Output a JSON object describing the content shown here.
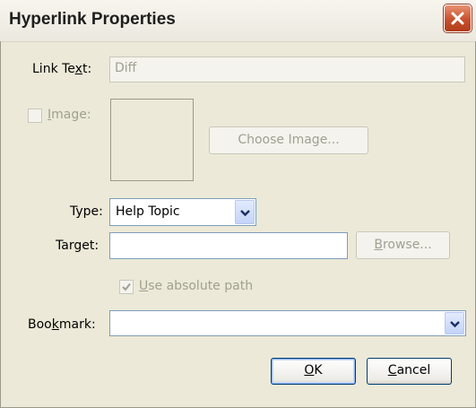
{
  "window": {
    "title": "Hyperlink Properties"
  },
  "link_text": {
    "label_pre": "Link Te",
    "label_accel": "x",
    "label_post": "t:",
    "value": "Diff"
  },
  "image": {
    "label_accel": "I",
    "label_post": "mage:",
    "checked": false,
    "choose_button_label": "Choose Image..."
  },
  "type": {
    "label": "Type:",
    "value": "Help Topic"
  },
  "target": {
    "label": "Target:",
    "value": "",
    "browse_accel": "B",
    "browse_post": "rowse..."
  },
  "absolute_path": {
    "label_accel": "U",
    "label_post": "se absolute path",
    "checked": true
  },
  "bookmark": {
    "label_pre": "Boo",
    "label_accel": "k",
    "label_post": "mark:",
    "value": ""
  },
  "buttons": {
    "ok_accel": "O",
    "ok_post": "K",
    "cancel_accel": "C",
    "cancel_post": "ancel"
  },
  "icons": {
    "close": "close-icon",
    "dropdown": "chevron-down-icon",
    "check": "checkmark-icon"
  }
}
